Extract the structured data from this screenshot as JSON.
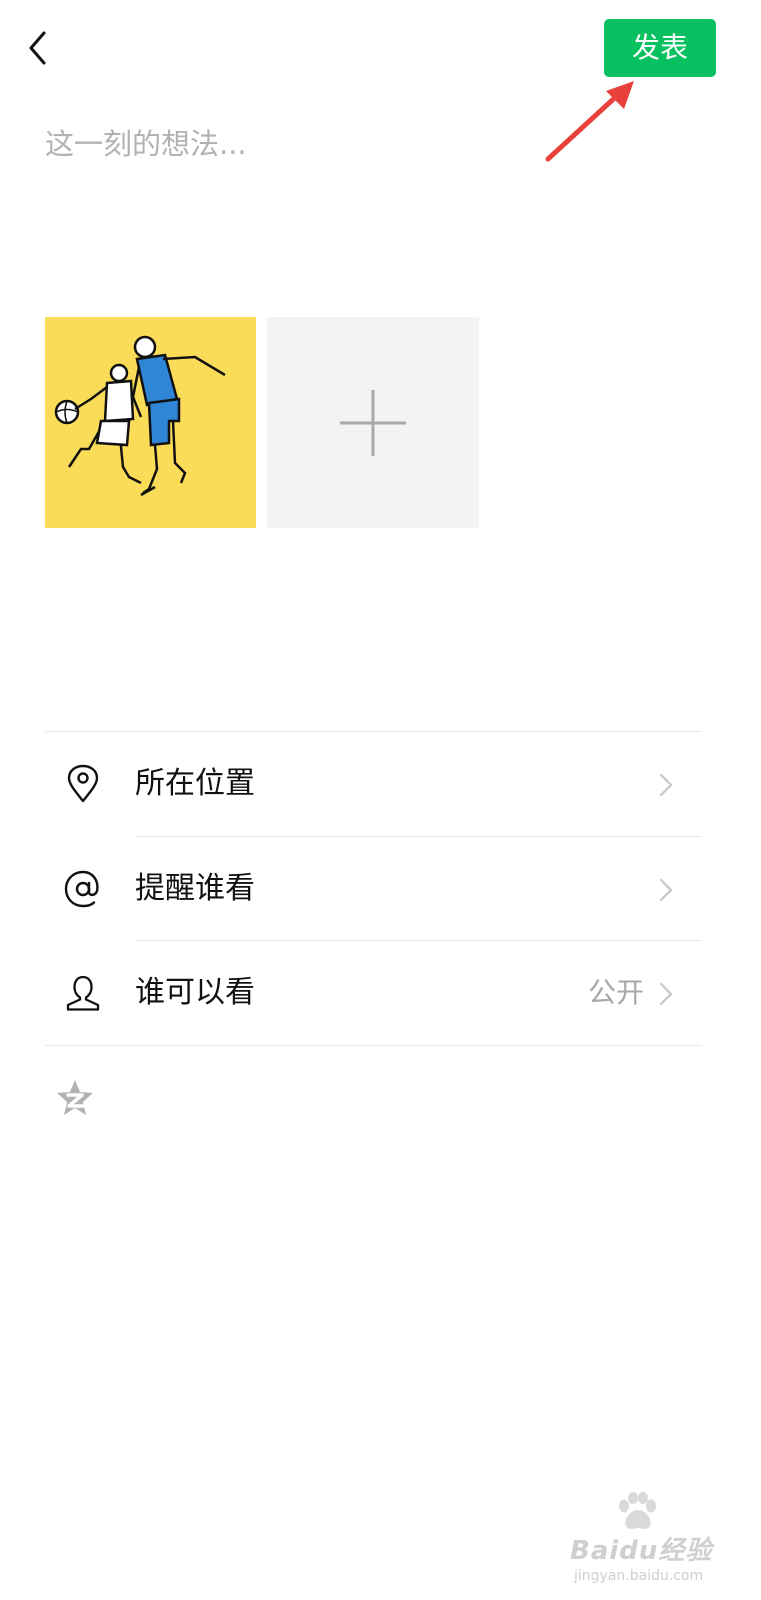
{
  "header": {
    "back_icon": "chevron-left-icon",
    "post_label": "发表",
    "post_color": "#07c160"
  },
  "composer": {
    "placeholder": "这一刻的想法...",
    "value": ""
  },
  "photos": {
    "attached_image": "basketball-players-drawing",
    "add_icon": "plus-icon"
  },
  "options": [
    {
      "icon": "location-pin-icon",
      "label": "所在位置",
      "value": ""
    },
    {
      "icon": "at-sign-icon",
      "label": "提醒谁看",
      "value": ""
    },
    {
      "icon": "person-icon",
      "label": "谁可以看",
      "value": "公开"
    }
  ],
  "qzone": {
    "icon": "qzone-star-icon"
  },
  "watermark": {
    "brand": "Baidu经验",
    "domain": "jingyan.baidu.com"
  },
  "colors": {
    "accent": "#07c160",
    "annotation_arrow": "#e8403a",
    "thumb_background": "#fbdc58",
    "player_jersey": "#2f86d6"
  }
}
